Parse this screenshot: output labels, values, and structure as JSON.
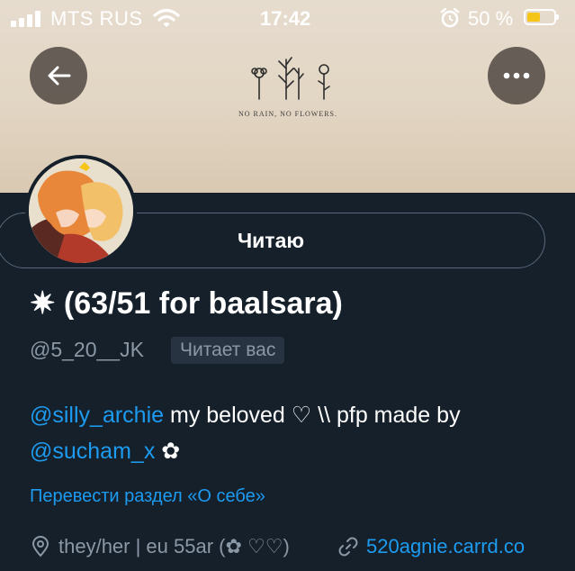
{
  "status_bar": {
    "carrier": "MTS RUS",
    "time": "17:42",
    "battery_percent": "50 %",
    "battery_level": 0.5,
    "battery_color": "#f5c518"
  },
  "header": {
    "back_icon": "arrow-left-icon",
    "more_icon": "more-horizontal-icon",
    "banner_caption": "NO RAIN, NO FLOWERS."
  },
  "profile": {
    "follow_button_label": "Читаю",
    "display_name": "✷ (63/51 for baalsara)",
    "handle": "@5_20__JK",
    "follows_you_badge": "Читает вас",
    "bio": {
      "mention_1": "@silly_archie",
      "text_1": " my beloved ♡ \\\\ pfp made by",
      "mention_2": "@sucham_x",
      "text_2": " ✿"
    },
    "translate_link": "Перевести раздел «О себе»",
    "location": "they/her | eu 55ar (✿ ♡♡)",
    "website": "520agnie.carrd.co"
  },
  "colors": {
    "background": "#15202b",
    "accent": "#1d9bf0",
    "muted": "#8b98a5"
  }
}
